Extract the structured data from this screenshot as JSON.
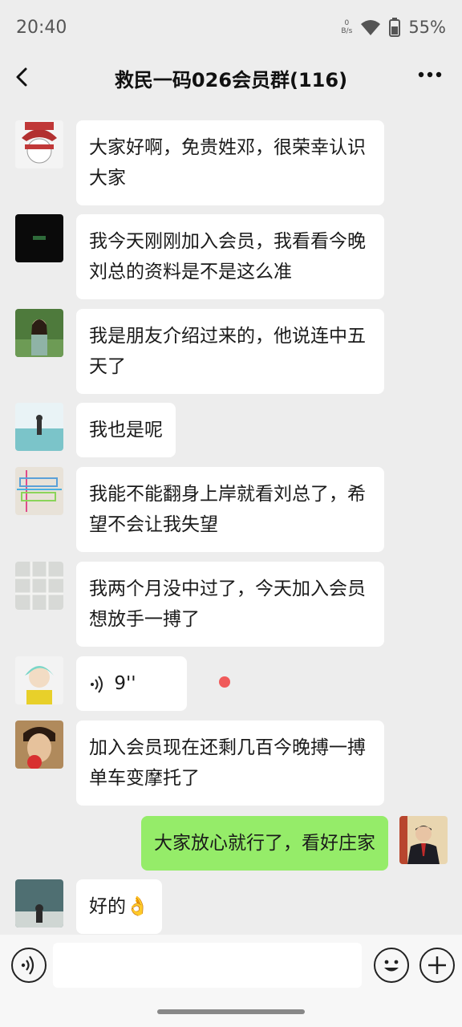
{
  "status_bar": {
    "time": "20:40",
    "network_speed": "0 B/s",
    "battery": "55%",
    "icons": [
      "wifi-icon",
      "battery-icon"
    ]
  },
  "header": {
    "title": "救民一码026会员群(116)",
    "back_icon": "chevron-left-icon",
    "more_icon": "more-horizontal-icon"
  },
  "messages": [
    {
      "sender": "other",
      "type": "text",
      "text": "大家好啊，免贵姓邓，很荣幸认识大家"
    },
    {
      "sender": "other",
      "type": "text",
      "text": "我今天刚刚加入会员，我看看今晚刘总的资料是不是这么准"
    },
    {
      "sender": "other",
      "type": "text",
      "text": "我是朋友介绍过来的，他说连中五天了"
    },
    {
      "sender": "other",
      "type": "text",
      "text": "我也是呢"
    },
    {
      "sender": "other",
      "type": "text",
      "text": "我能不能翻身上岸就看刘总了，希望不会让我失望"
    },
    {
      "sender": "other",
      "type": "text",
      "text": "我两个月没中过了，今天加入会员想放手一搏了"
    },
    {
      "sender": "other",
      "type": "voice",
      "text": "9''",
      "unread": true
    },
    {
      "sender": "other",
      "type": "text",
      "text": "加入会员现在还剩几百今晚搏一搏单车变摩托了"
    },
    {
      "sender": "me",
      "type": "text",
      "text": "大家放心就行了，看好庄家"
    },
    {
      "sender": "other",
      "type": "text",
      "text": "好的👌"
    }
  ],
  "input_bar": {
    "voice_icon": "voice-icon",
    "emoji_icon": "emoji-icon",
    "plus_icon": "plus-icon"
  },
  "colors": {
    "background": "#ededed",
    "my_bubble": "#95ec69",
    "other_bubble": "#ffffff",
    "unread_dot": "#f05a5a"
  }
}
